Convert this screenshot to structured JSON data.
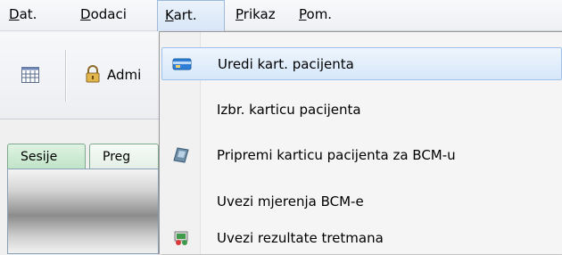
{
  "menubar": {
    "items": [
      {
        "label_first": "D",
        "label_rest": "at."
      },
      {
        "label_first": "D",
        "label_rest": "odaci"
      },
      {
        "label_first": "K",
        "label_rest": "art."
      },
      {
        "label_first": "P",
        "label_rest": "rikaz"
      },
      {
        "label_first": "P",
        "label_rest": "om."
      }
    ]
  },
  "toolbar": {
    "admin_label": "Admi"
  },
  "tabs": [
    {
      "label": "Sesije"
    },
    {
      "label": "Preg"
    }
  ],
  "dropdown": {
    "items": [
      {
        "label": "Uredi kart. pacijenta",
        "icon": "card-icon"
      },
      {
        "label": "Izbr. karticu pacijenta",
        "icon": ""
      },
      {
        "label": "Pripremi karticu pacijenta za BCM-u",
        "icon": "device-card-icon"
      },
      {
        "label": "Uvezi mjerenja BCM-e",
        "icon": ""
      },
      {
        "label": "Uvezi rezultate tretmana",
        "icon": "import-results-icon"
      }
    ]
  },
  "colors": {
    "menu_highlight": "#d8e6f7",
    "tab_active": "#bfe3c7",
    "dropdown_bg": "#f5f5f5"
  }
}
